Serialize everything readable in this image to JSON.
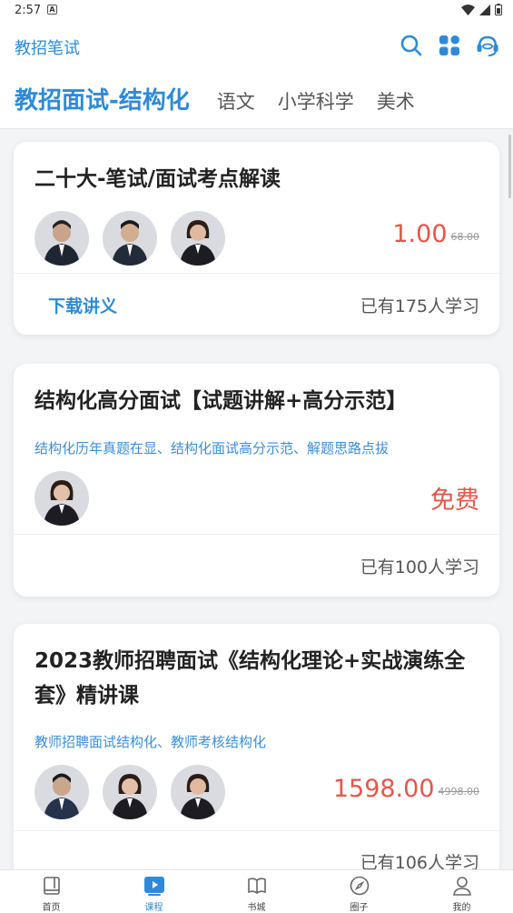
{
  "status": {
    "time": "2:57",
    "a_icon": "A"
  },
  "header": {
    "brand": "教招笔试"
  },
  "tabs": [
    {
      "label": "教招面试-结构化"
    },
    {
      "label": "语文"
    },
    {
      "label": "小学科学"
    },
    {
      "label": "美术"
    }
  ],
  "cards": [
    {
      "title": "二十大-笔试/面试考点解读",
      "price": "1.00",
      "old_price": "68.00",
      "download": "下载讲义",
      "learners": "已有175人学习"
    },
    {
      "title": "结构化高分面试【试题讲解+高分示范】",
      "subtitle": "结构化历年真题在显、结构化面试高分示范、解题思路点拔",
      "price": "免费",
      "learners": "已有100人学习"
    },
    {
      "title": "2023教师招聘面试《结构化理论+实战演练全套》精讲课",
      "subtitle": "教师招聘面试结构化、教师考核结构化",
      "price": "1598.00",
      "old_price": "4998.00",
      "learners": "已有106人学习"
    }
  ],
  "nav": [
    {
      "label": "首页",
      "icon": "home-book-icon"
    },
    {
      "label": "课程",
      "icon": "course-play-icon"
    },
    {
      "label": "书城",
      "icon": "bookstore-icon"
    },
    {
      "label": "圈子",
      "icon": "compass-icon"
    },
    {
      "label": "我的",
      "icon": "profile-icon"
    }
  ],
  "colors": {
    "accent": "#2e8ad8",
    "price": "#e4574a"
  }
}
